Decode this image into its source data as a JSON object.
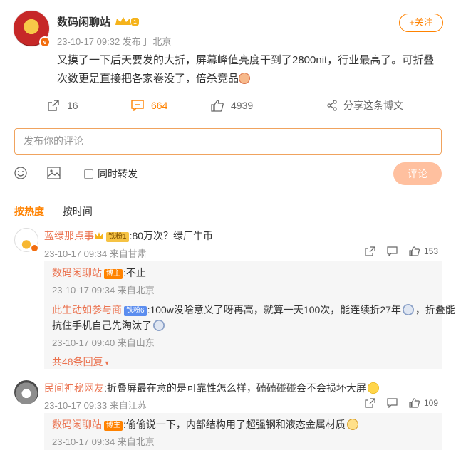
{
  "post": {
    "author": "数码闲聊站",
    "level": "1",
    "meta": "23-10-17 09:32  发布于 北京",
    "follow_label": "+关注",
    "text": "又摸了一下后天要发的大折，屏幕峰值亮度干到了2800nit，行业最高了。可折叠次数更是直接把各家卷没了，倍杀竞品",
    "stats": {
      "repost": "16",
      "comment": "664",
      "like": "4939",
      "share_label": "分享这条博文"
    }
  },
  "composer": {
    "placeholder": "发布你的评论",
    "repost_label": "同时转发",
    "submit_label": "评论"
  },
  "sort": {
    "hot": "按热度",
    "time": "按时间"
  },
  "comments": [
    {
      "user": "蓝绿那点事",
      "badge": "铁粉1",
      "text": ":80万次？绿厂牛币",
      "meta": "23-10-17 09:34 来自甘肃",
      "likes": "153",
      "replies": [
        {
          "user": "数码闲聊站",
          "badge": "博主",
          "text": ":不止",
          "meta": "23-10-17 09:34 来自北京"
        },
        {
          "user": "此生动如参与商",
          "badge": "铁粉6",
          "text_line1": ":100w没啥意义了呀再高，就算一天100次，能连续折27年",
          "text_line1b": "，折叠能",
          "text_line2": "抗住手机自己先淘汰了",
          "meta": "23-10-17 09:40 来自山东"
        }
      ],
      "more": "共48条回复"
    },
    {
      "user": "民间神秘网友",
      "text": ":折叠屏最在意的是可靠性怎么样，磕磕碰碰会不会损坏大屏",
      "meta": "23-10-17 09:33 来自江苏",
      "likes": "109",
      "replies": [
        {
          "user": "数码闲聊站",
          "badge": "博主",
          "text": ":偷偷说一下，内部结构用了超强钢和液态金属材质",
          "meta": "23-10-17 09:34 来自北京"
        }
      ]
    }
  ],
  "colors": {
    "accent": "#ff8200",
    "username": "#eb7350",
    "meta": "#939393"
  }
}
